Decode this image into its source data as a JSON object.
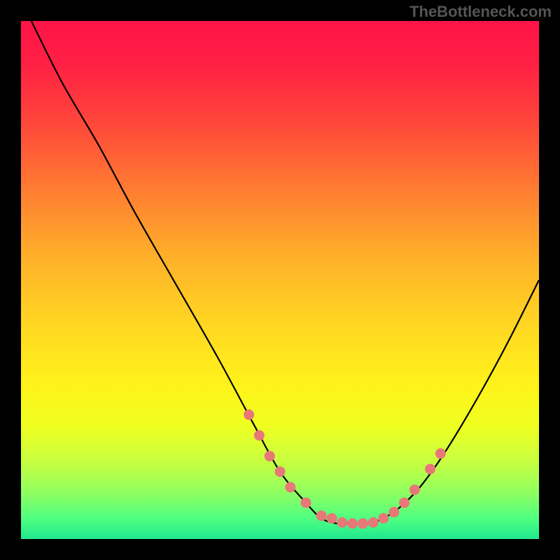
{
  "watermark": "TheBottleneck.com",
  "chart_data": {
    "type": "line",
    "title": "",
    "xlabel": "",
    "ylabel": "",
    "xlim": [
      0,
      100
    ],
    "ylim": [
      0,
      100
    ],
    "grid": false,
    "legend": false,
    "curve": {
      "name": "bottleneck-curve",
      "x": [
        2,
        8,
        15,
        22,
        30,
        38,
        45,
        50,
        55,
        58,
        61,
        64,
        67,
        70,
        73,
        77,
        82,
        88,
        94,
        100
      ],
      "y": [
        100,
        88,
        76,
        63,
        49,
        35,
        22,
        13,
        7,
        4,
        3,
        3,
        3,
        4,
        6,
        10,
        17,
        27,
        38,
        50
      ]
    },
    "markers": {
      "name": "highlight-dots",
      "color": "#e87878",
      "x": [
        44,
        46,
        48,
        50,
        52,
        55,
        58,
        60,
        62,
        64,
        66,
        68,
        70,
        72,
        74,
        76,
        79,
        81
      ],
      "y": [
        24,
        20,
        16,
        13,
        10,
        7,
        4.5,
        4,
        3.2,
        3,
        3,
        3.2,
        4,
        5.2,
        7,
        9.5,
        13.5,
        16.5
      ]
    },
    "background": {
      "type": "vertical-gradient",
      "stops": [
        {
          "pos": 0.0,
          "color": "#ff1448"
        },
        {
          "pos": 0.45,
          "color": "#ffae2a"
        },
        {
          "pos": 0.7,
          "color": "#fff21a"
        },
        {
          "pos": 1.0,
          "color": "#20e890"
        }
      ]
    }
  }
}
